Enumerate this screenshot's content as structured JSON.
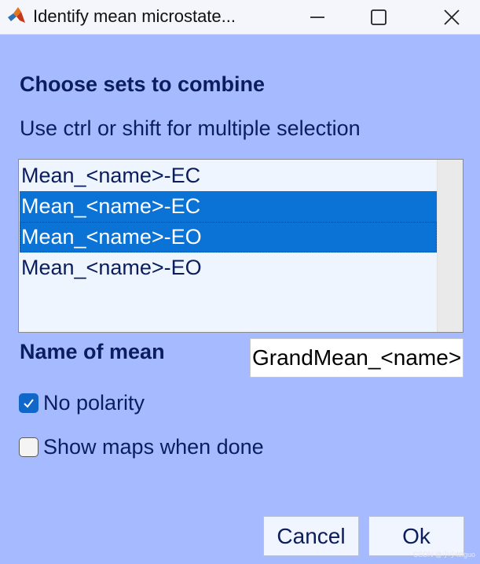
{
  "window": {
    "title": "Identify mean microstate...",
    "icon": "matlab-logo-icon"
  },
  "dialog": {
    "heading": "Choose sets to combine",
    "instruction": "Use ctrl or shift for multiple selection",
    "list_items": [
      {
        "label": "Mean_<name>-EC",
        "selected": false
      },
      {
        "label": "Mean_<name>-EC",
        "selected": true
      },
      {
        "label": "Mean_<name>-EO",
        "selected": true
      },
      {
        "label": "Mean_<name>-EO",
        "selected": false
      }
    ],
    "name_label": "Name of mean",
    "name_value": "GrandMean_<name>",
    "no_polarity_label": "No polarity",
    "no_polarity_checked": true,
    "show_maps_label": "Show maps when done",
    "show_maps_checked": false,
    "cancel_label": "Cancel",
    "ok_label": "Ok"
  },
  "watermark": "CSDN @小小fifiguo",
  "colors": {
    "background": "#a6bbff",
    "selection": "#0b72d6",
    "text": "#0b1d5c"
  }
}
